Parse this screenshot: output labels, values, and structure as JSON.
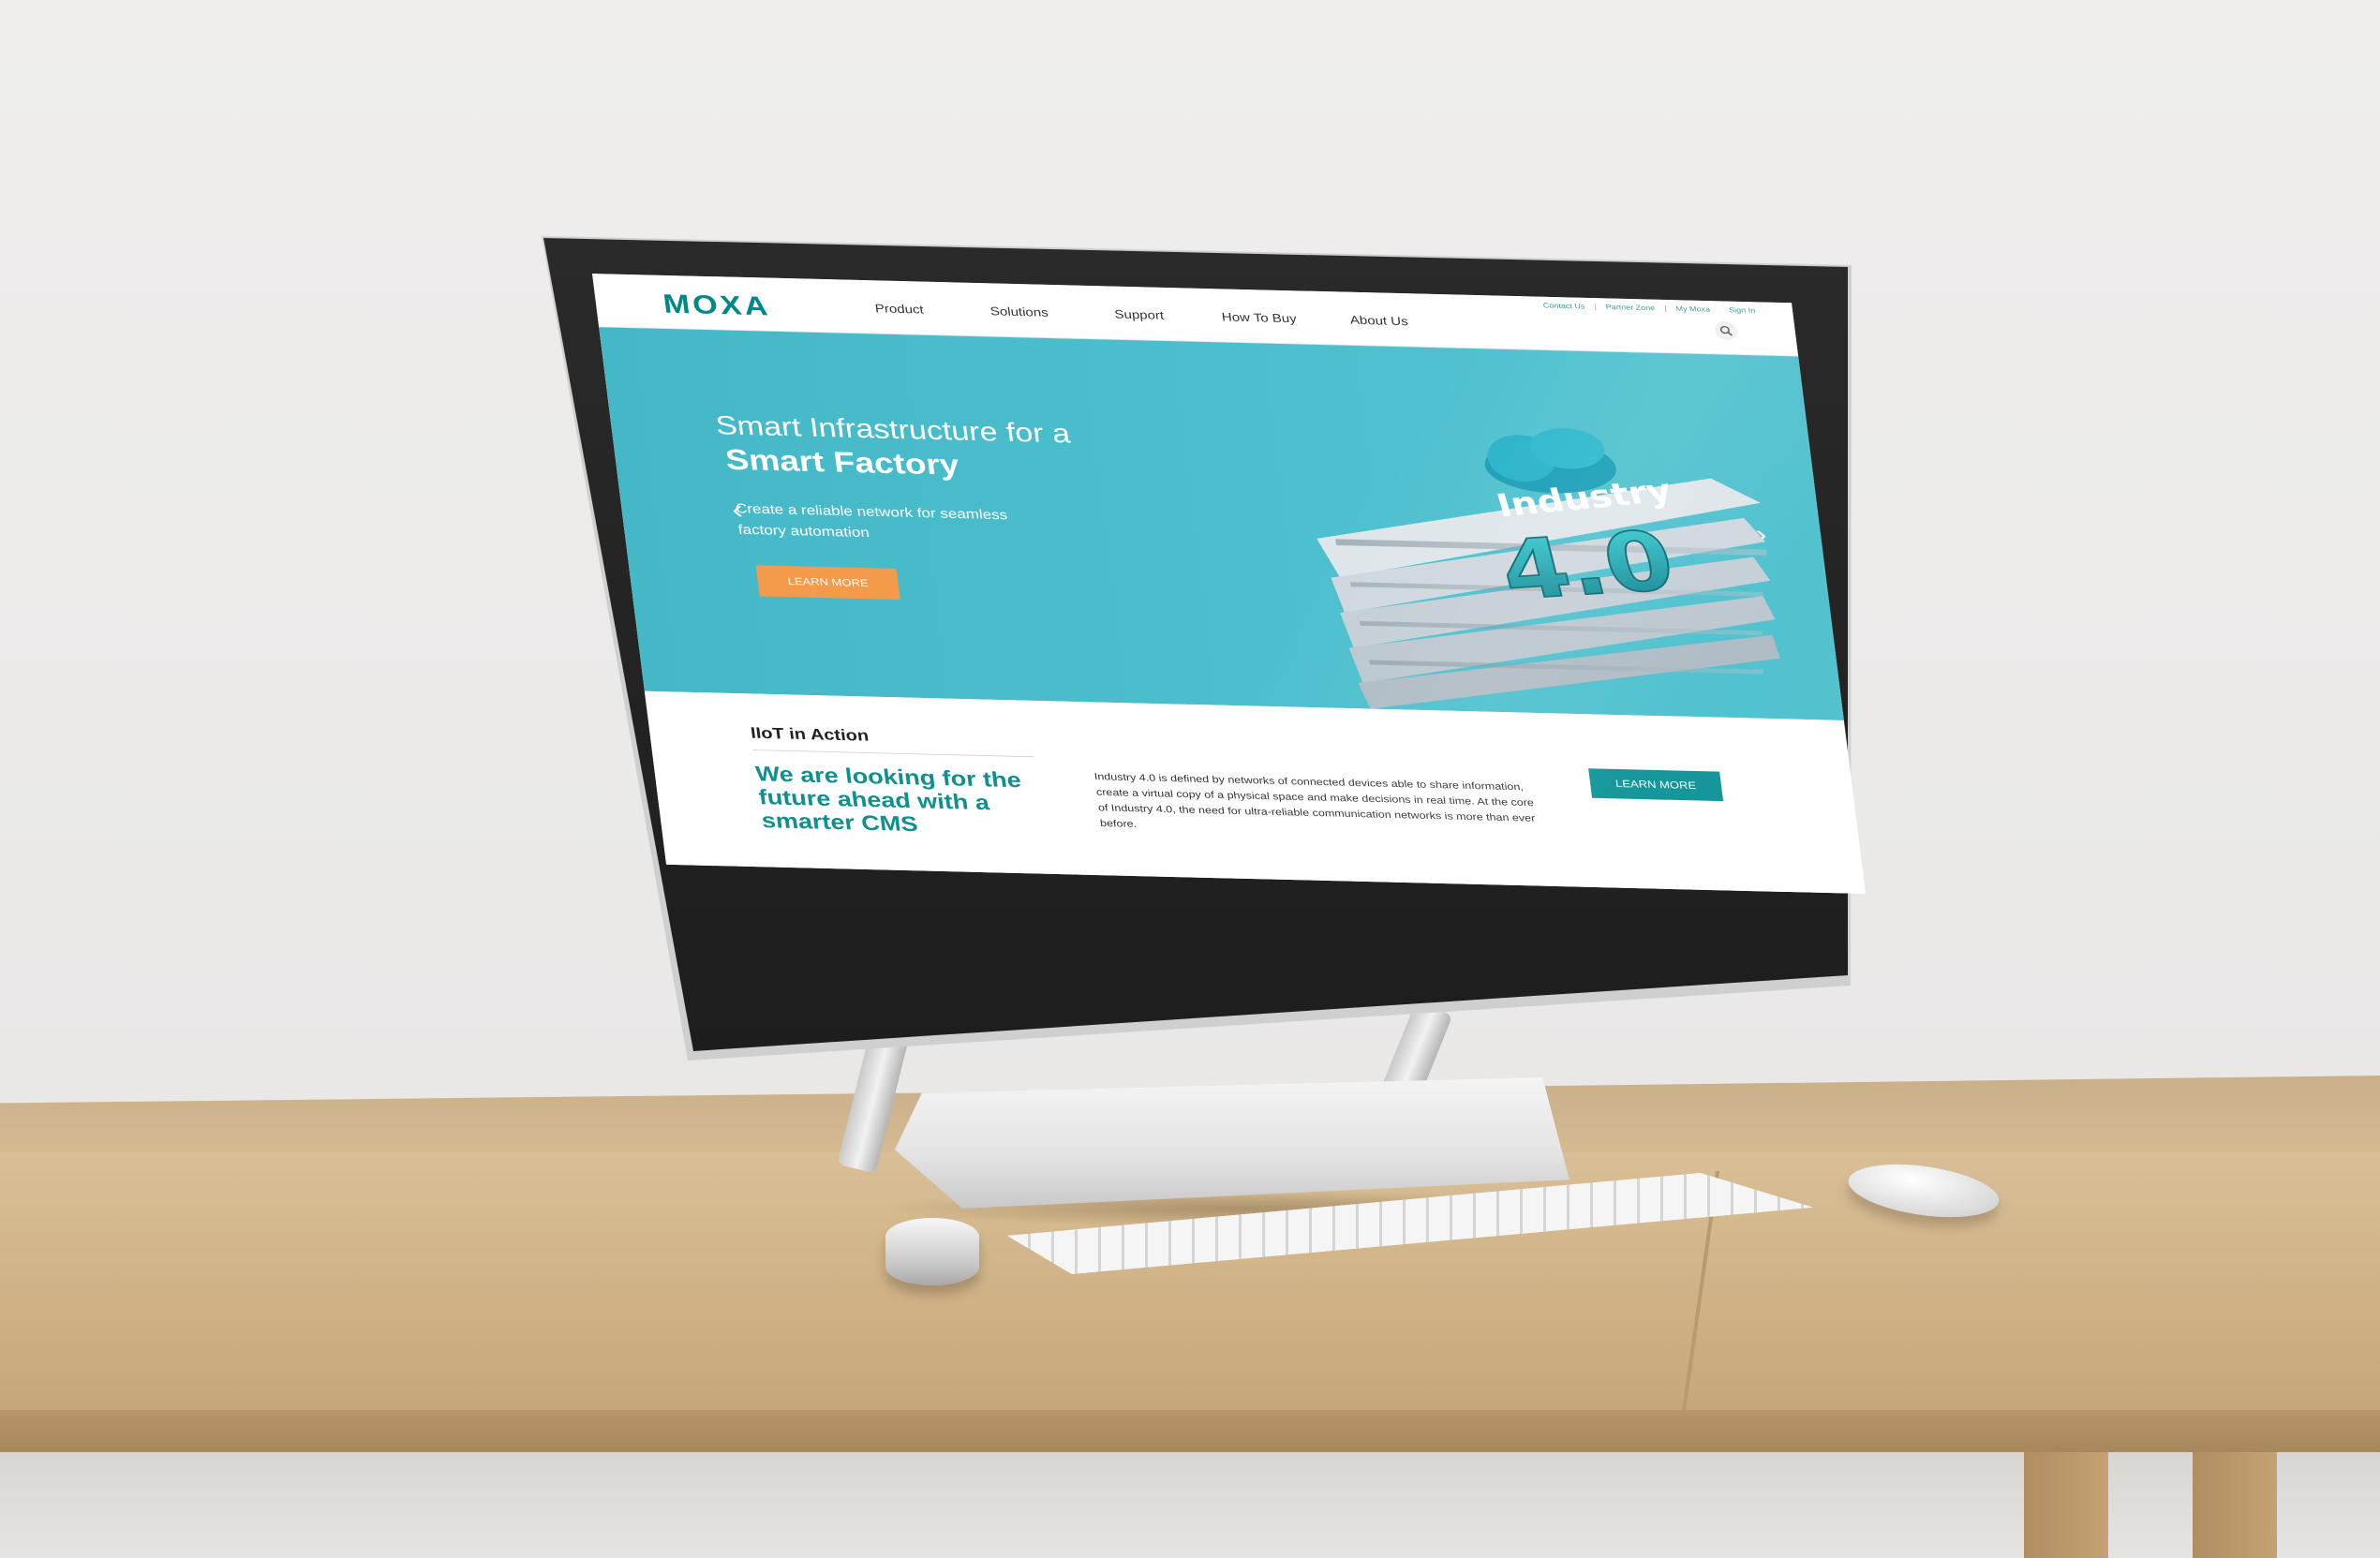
{
  "site": {
    "logo": "MOXA",
    "brand_color": "#008787"
  },
  "top_links": [
    "Contact Us",
    "Partner Zone",
    "My Moxa",
    "Sign In"
  ],
  "nav": {
    "items": [
      "Product",
      "Solutions",
      "Support",
      "How To Buy",
      "About Us"
    ],
    "search_icon": "search-icon"
  },
  "hero": {
    "title_light": "Smart Infrastructure for a",
    "title_bold": "Smart Factory",
    "subtitle": "Create a reliable network for seamless factory automation",
    "cta": "LEARN MORE",
    "art_word": "Industry",
    "art_number": "4.0",
    "background_color": "#4dbfcd",
    "cta_color": "#f39a4b"
  },
  "iiot": {
    "label": "IIoT in Action",
    "heading": "We are looking for the future ahead with a smarter CMS",
    "body": "Industry 4.0 is defined by networks of connected devices able to share information, create a virtual copy of a physical space and make decisions in real time. At the core of Industry 4.0, the need for ultra-reliable communication networks is more than ever before.",
    "cta": "LEARN MORE",
    "cta_color": "#14969a"
  }
}
